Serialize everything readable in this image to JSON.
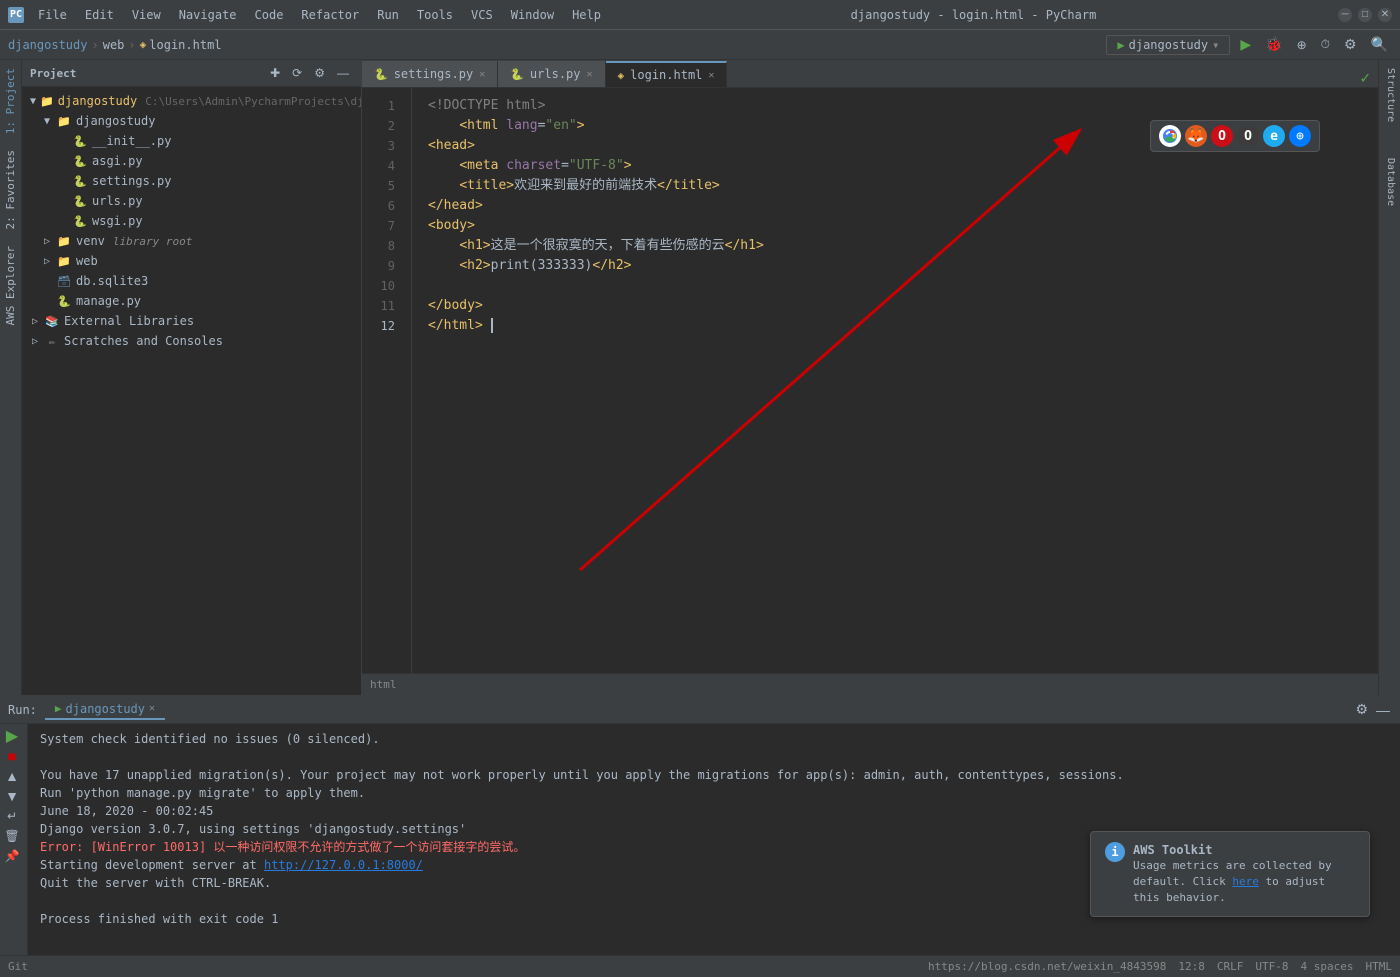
{
  "window": {
    "title": "djangostudy - login.html - PyCharm",
    "logo": "PC"
  },
  "menu": {
    "items": [
      "File",
      "Edit",
      "View",
      "Navigate",
      "Code",
      "Refactor",
      "Run",
      "Tools",
      "VCS",
      "Window",
      "Help"
    ]
  },
  "toolbar": {
    "breadcrumb": [
      "djangostudy",
      "web",
      "login.html"
    ],
    "run_config": "djangostudy"
  },
  "sidebar": {
    "title": "Project",
    "root": {
      "name": "djangostudy",
      "path": "C:\\Users\\Admin\\PycharmProjects\\djang...",
      "children": [
        {
          "name": "djangostudy",
          "type": "folder",
          "expanded": true,
          "children": [
            {
              "name": "__init__.py",
              "type": "py"
            },
            {
              "name": "asgi.py",
              "type": "py"
            },
            {
              "name": "settings.py",
              "type": "py"
            },
            {
              "name": "urls.py",
              "type": "py"
            },
            {
              "name": "wsgi.py",
              "type": "py"
            }
          ]
        },
        {
          "name": "venv",
          "type": "folder",
          "label": "library root",
          "expanded": false
        },
        {
          "name": "web",
          "type": "folder",
          "expanded": false
        },
        {
          "name": "db.sqlite3",
          "type": "sqlite"
        },
        {
          "name": "manage.py",
          "type": "py"
        }
      ]
    },
    "external": "External Libraries",
    "scratches": "Scratches and Consoles"
  },
  "editor_tabs": [
    {
      "id": "settings",
      "name": "settings.py",
      "type": "py",
      "modified": false
    },
    {
      "id": "urls",
      "name": "urls.py",
      "type": "py",
      "modified": false
    },
    {
      "id": "login",
      "name": "login.html",
      "type": "html",
      "modified": false,
      "active": true
    }
  ],
  "code_lines": [
    {
      "num": 1,
      "content": "<!DOCTYPE html>"
    },
    {
      "num": 2,
      "content": "    <html lang=\"en\">"
    },
    {
      "num": 3,
      "content": "<head>"
    },
    {
      "num": 4,
      "content": "    <meta charset=\"UTF-8\">"
    },
    {
      "num": 5,
      "content": "    <title>欢迎来到最好的前端技术</title>"
    },
    {
      "num": 6,
      "content": "</head>"
    },
    {
      "num": 7,
      "content": "<body>"
    },
    {
      "num": 8,
      "content": "    <h1>这是一个很寂寞的天，下着有些伤感的云</h1>"
    },
    {
      "num": 9,
      "content": "    <h2>print(333333)</h2>"
    },
    {
      "num": 10,
      "content": ""
    },
    {
      "num": 11,
      "content": "</body>"
    },
    {
      "num": 12,
      "content": "</html>"
    }
  ],
  "editor_status": {
    "type": "html",
    "encoding": "UTF-8",
    "line_sep": "CRLF"
  },
  "run_panel": {
    "tab_name": "djangostudy",
    "console_lines": [
      {
        "type": "normal",
        "text": "System check identified no issues (0 silenced)."
      },
      {
        "type": "normal",
        "text": ""
      },
      {
        "type": "normal",
        "text": "You have 17 unapplied migration(s). Your project may not work properly until you apply the migrations for app(s): admin, auth, contenttypes, sessions."
      },
      {
        "type": "normal",
        "text": "Run 'python manage.py migrate' to apply them."
      },
      {
        "type": "normal",
        "text": "June 18, 2020 - 00:02:45"
      },
      {
        "type": "normal",
        "text": "Django version 3.0.7, using settings 'djangostudy.settings'"
      },
      {
        "type": "error",
        "text": "Error: [WinError 10013] 以一种访问权限不允许的方式做了一个访问套接字的尝试。"
      },
      {
        "type": "normal",
        "text": "Starting development server at ",
        "link": "http://127.0.0.1:8000/"
      },
      {
        "type": "normal",
        "text": "Quit the server with CTRL-BREAK."
      },
      {
        "type": "normal",
        "text": ""
      },
      {
        "type": "normal",
        "text": "Process finished with exit code 1"
      }
    ]
  },
  "aws_notification": {
    "title": "AWS Toolkit",
    "body": "Usage metrics are collected by default. Click",
    "link": "here",
    "body2": " to adjust this behavior."
  },
  "status_bar": {
    "git": "Git",
    "line_col": "12:8",
    "crlf": "CRLF",
    "encoding": "UTF-8",
    "indent": "4 spaces",
    "type": "HTML",
    "url": "https://blog.csdn.net/weixin_4843598"
  },
  "browser_icons": [
    "Chrome",
    "Firefox",
    "Opera-red",
    "Opera-dark",
    "IE",
    "Safari"
  ],
  "right_panel_tabs": [
    "Structure",
    "Database"
  ],
  "left_panel_tabs": [
    "1: Project",
    "2: Favorites",
    "AWS Explorer"
  ]
}
